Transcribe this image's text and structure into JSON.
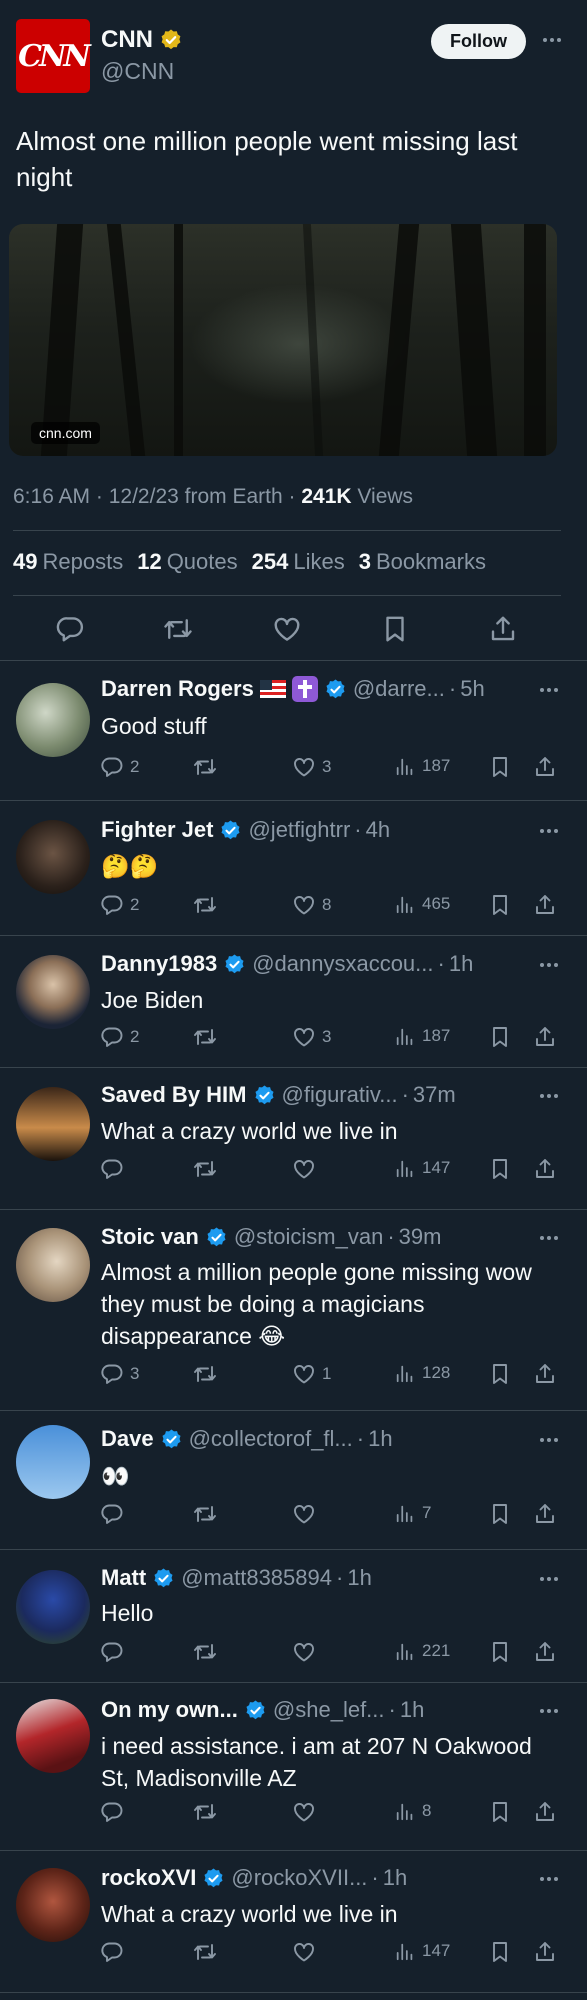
{
  "main": {
    "logo_text": "CNN",
    "name": "CNN",
    "handle": "@CNN",
    "follow_label": "Follow",
    "text": "Almost one million people went missing last night",
    "media_source": "cnn.com",
    "time": "6:16 AM",
    "date": "12/2/23",
    "via": "from Earth",
    "views_count": "241K",
    "views_label": "Views",
    "reposts_count": "49",
    "reposts_label": "Reposts",
    "quotes_count": "12",
    "quotes_label": "Quotes",
    "likes_count": "254",
    "likes_label": "Likes",
    "bookmarks_count": "3",
    "bookmarks_label": "Bookmarks"
  },
  "colors": {
    "background": "#15202b",
    "divider": "#38444d",
    "muted": "#8b98a5",
    "verified": "#1d9bf0",
    "gold_verified": "#e2b719",
    "cnn_red": "#cc0000"
  },
  "replies": [
    {
      "name": "Darren Rogers",
      "badges": [
        "us-flag",
        "latin-cross"
      ],
      "handle": "@darre...",
      "time": "5h",
      "text": "Good stuff",
      "replies": "2",
      "reposts": "",
      "likes": "3",
      "views": "187"
    },
    {
      "name": "Fighter Jet",
      "badges": [],
      "handle": "@jetfightrr",
      "time": "4h",
      "text": "🤔🤔",
      "replies": "2",
      "reposts": "",
      "likes": "8",
      "views": "465"
    },
    {
      "name": "Danny1983",
      "badges": [],
      "handle": "@dannysxaccou...",
      "time": "1h",
      "text": "Joe Biden",
      "replies": "2",
      "reposts": "",
      "likes": "3",
      "views": "187"
    },
    {
      "name": "Saved By HIM",
      "badges": [],
      "handle": "@figurativ...",
      "time": "37m",
      "text": "What a crazy world we live in",
      "replies": "",
      "reposts": "",
      "likes": "",
      "views": "147"
    },
    {
      "name": "Stoic van",
      "badges": [],
      "handle": "@stoicism_van",
      "time": "39m",
      "text": "Almost a million people gone missing wow they must be doing a magicians disappearance 😂",
      "replies": "3",
      "reposts": "",
      "likes": "1",
      "views": "128"
    },
    {
      "name": "Dave",
      "badges": [],
      "handle": "@collectorof_fl...",
      "time": "1h",
      "text": "👀",
      "replies": "",
      "reposts": "",
      "likes": "",
      "views": "7"
    },
    {
      "name": "Matt",
      "badges": [],
      "handle": "@matt8385894",
      "time": "1h",
      "text": "Hello",
      "replies": "",
      "reposts": "",
      "likes": "",
      "views": "221"
    },
    {
      "name": "On my own...",
      "badges": [],
      "handle": "@she_lef...",
      "time": "1h",
      "text": "i need assistance. i am at 207 N Oakwood St, Madisonville AZ",
      "replies": "",
      "reposts": "",
      "likes": "",
      "views": "8"
    },
    {
      "name": "rockoXVI",
      "badges": [],
      "handle": "@rockoXVII...",
      "time": "1h",
      "text": "What a crazy world we live in",
      "replies": "",
      "reposts": "",
      "likes": "",
      "views": "147"
    }
  ]
}
